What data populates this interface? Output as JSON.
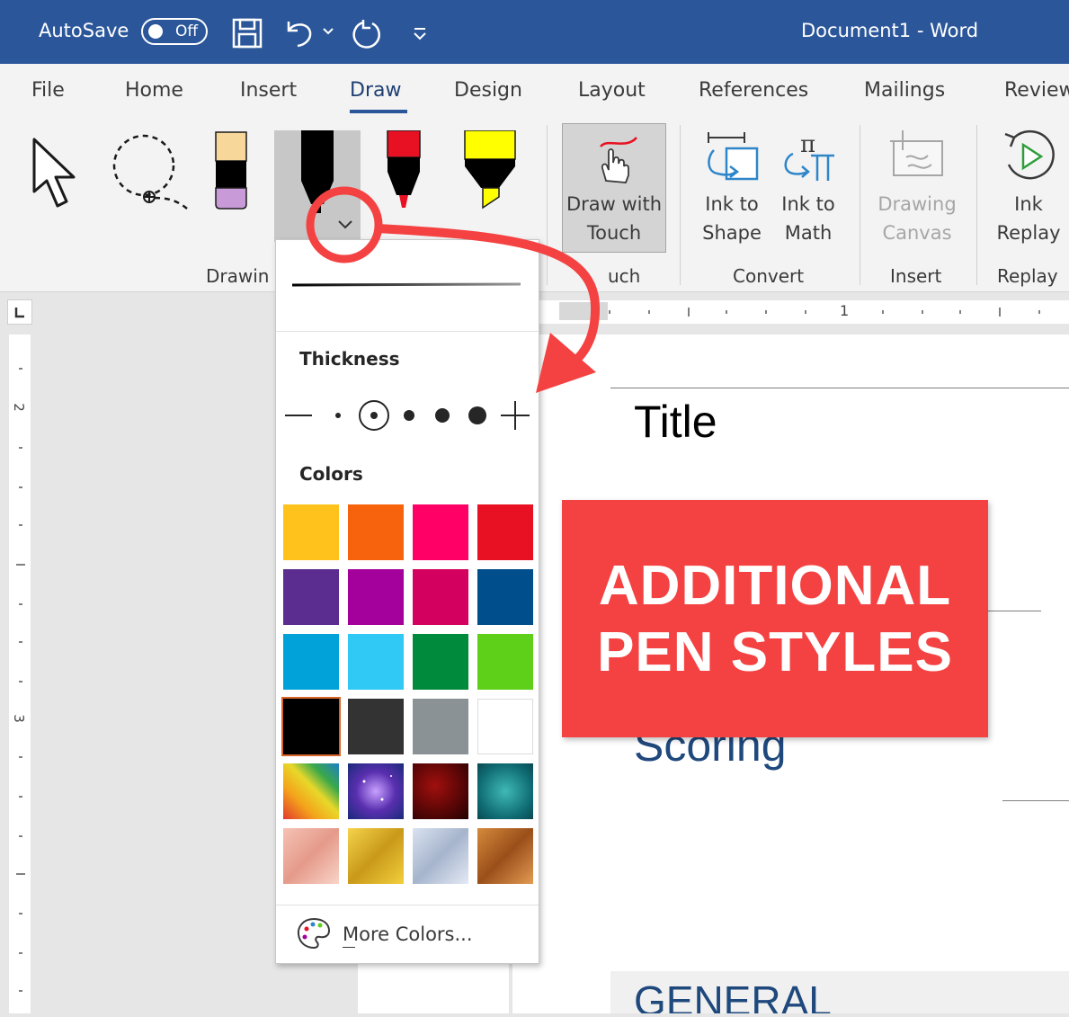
{
  "titlebar": {
    "autosave_label": "AutoSave",
    "autosave_state": "Off",
    "document_title": "Document1  -  Word",
    "icons": [
      "save-icon",
      "undo-icon",
      "undo-dropdown-icon",
      "redo-icon",
      "customize-toolbar-icon"
    ]
  },
  "tabs": [
    {
      "label": "File"
    },
    {
      "label": "Home"
    },
    {
      "label": "Insert"
    },
    {
      "label": "Draw",
      "active": true
    },
    {
      "label": "Design"
    },
    {
      "label": "Layout"
    },
    {
      "label": "References"
    },
    {
      "label": "Mailings"
    },
    {
      "label": "Review"
    }
  ],
  "ribbon": {
    "draw_with_touch": [
      "Draw with",
      "Touch"
    ],
    "ink_to_shape": [
      "Ink to",
      "Shape"
    ],
    "ink_to_math": [
      "Ink to",
      "Math"
    ],
    "drawing_canvas": [
      "Drawing",
      "Canvas"
    ],
    "ink_replay": [
      "Ink",
      "Replay"
    ],
    "groups": {
      "drawing": "Drawin",
      "touch": "uch",
      "convert": "Convert",
      "insert": "Insert",
      "replay": "Replay"
    }
  },
  "ruler": {
    "h_mark": "1",
    "v_marks": [
      "2",
      "3"
    ]
  },
  "dropdown": {
    "thickness_label": "Thickness",
    "colors_label": "Colors",
    "more_colors": "More Colors...",
    "swatches": [
      "#ffc11b",
      "#f7630c",
      "#ff0066",
      "#e81123",
      "#5c2d91",
      "#a4009c",
      "#d40060",
      "#004e8c",
      "#00a2d9",
      "#30c8f5",
      "#008a3c",
      "#5fd01a",
      "#000000",
      "#333333",
      "#8a9296",
      "#ffffff"
    ],
    "selected_swatch": 12,
    "textures": [
      "rainbow",
      "galaxy",
      "lava",
      "ocean",
      "rose-gold",
      "gold",
      "silver",
      "bronze"
    ]
  },
  "document": {
    "title": "Title",
    "heading_scoring": "Scoring",
    "heading_general": "GENERAL"
  },
  "callout": {
    "line1": "ADDITIONAL",
    "line2": "PEN STYLES",
    "color": "#f44242"
  }
}
